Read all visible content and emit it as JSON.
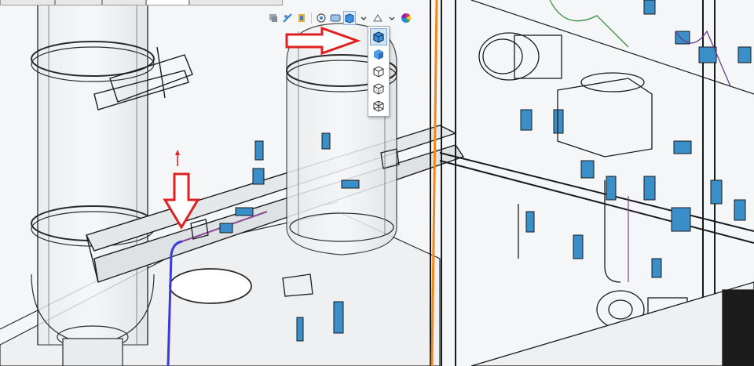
{
  "viewport": {
    "background_color": "#f4f6f8",
    "orange_beam_color": "#f08a1c",
    "blue_pipe_color": "#3b3bd6",
    "annotation_arrow_color": "#e02020"
  },
  "tabs": [
    {
      "label": ""
    },
    {
      "label": ""
    },
    {
      "label": ""
    },
    {
      "label": ""
    }
  ],
  "heads_up_toolbar": {
    "items": [
      {
        "icon": "previous-view-icon"
      },
      {
        "icon": "section-view-icon"
      },
      {
        "icon": "dynamic-annotation-icon"
      },
      {
        "icon": "view-orientation-icon"
      },
      {
        "icon": "display-style-icon"
      },
      {
        "icon": "hide-show-items-icon"
      },
      {
        "icon": "edit-appearance-icon"
      }
    ],
    "active_item": "display-style-icon"
  },
  "display_style_dropdown": {
    "options": [
      {
        "icon": "shaded-with-edges-icon",
        "selected": true
      },
      {
        "icon": "shaded-icon",
        "selected": false
      },
      {
        "icon": "hidden-lines-removed-icon",
        "selected": false
      },
      {
        "icon": "hidden-lines-visible-icon",
        "selected": false
      },
      {
        "icon": "wireframe-icon",
        "selected": false
      }
    ]
  },
  "annotations": [
    {
      "icon": "right-arrow-icon",
      "points_to": "shaded-with-edges-icon"
    },
    {
      "icon": "down-arrow-icon",
      "points_to": "blue-pipe-end"
    }
  ]
}
